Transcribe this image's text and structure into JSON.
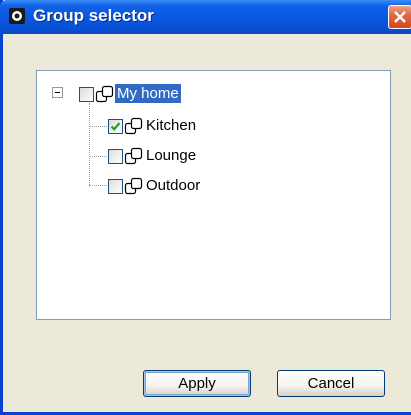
{
  "window": {
    "title": "Group selector",
    "accent": "#0a58e0"
  },
  "icons": {
    "title": "app-icon",
    "close": "close-icon",
    "node": "group-icon",
    "expander": "collapse-icon"
  },
  "tree": {
    "root": {
      "label": "My home",
      "checked": false,
      "expanded": true,
      "selected": true
    },
    "children": [
      {
        "label": "Kitchen",
        "checked": true
      },
      {
        "label": "Lounge",
        "checked": false
      },
      {
        "label": "Outdoor",
        "checked": false
      }
    ]
  },
  "buttons": {
    "apply_label": "Apply",
    "cancel_label": "Cancel"
  }
}
